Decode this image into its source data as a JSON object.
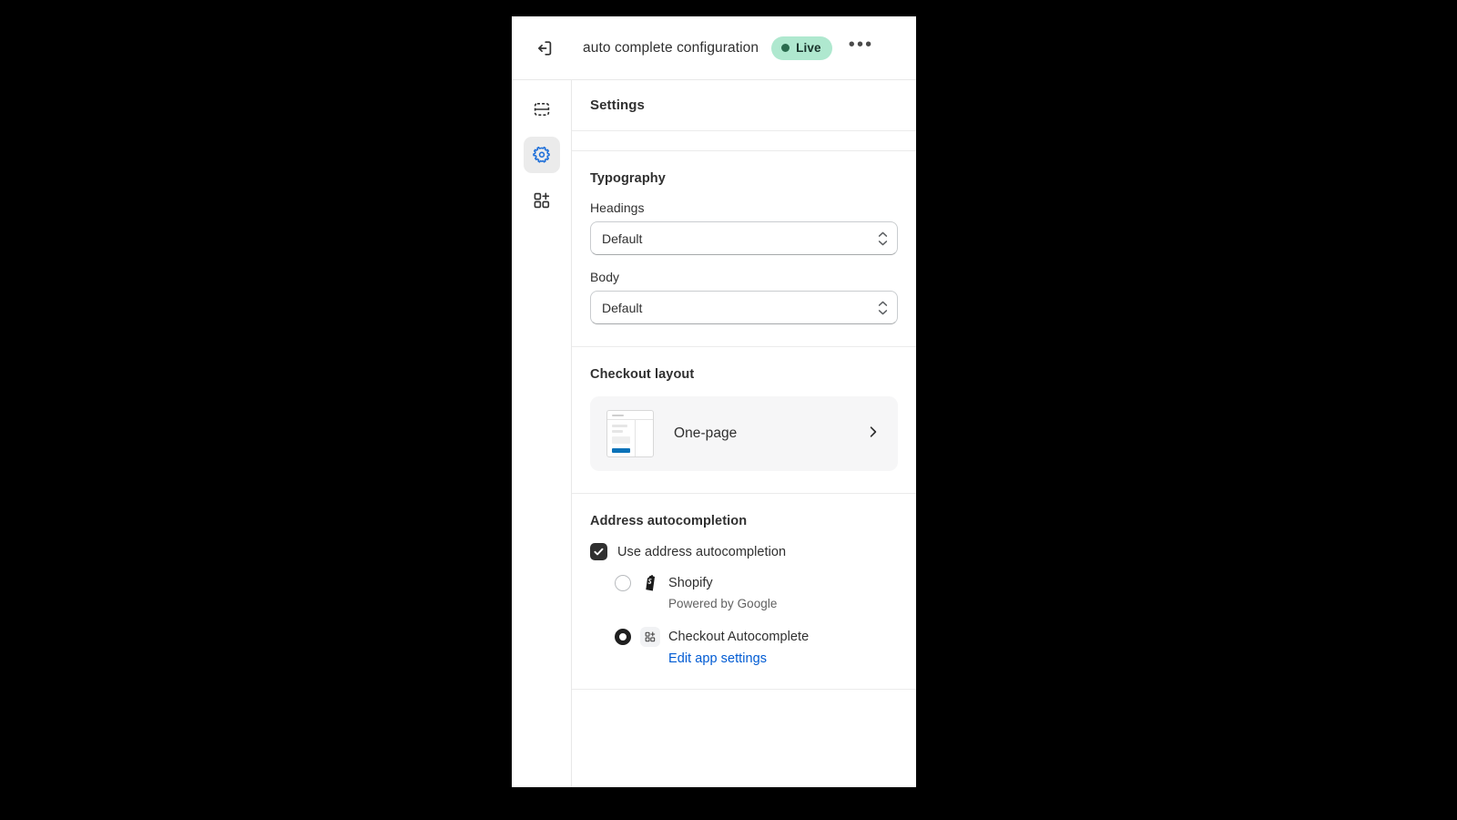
{
  "window": {
    "topbar": {
      "exit_icon": "exit-icon",
      "title": "auto complete configuration",
      "status_badge": {
        "label": "Live",
        "dot_color": "#2a6b4e",
        "background_color": "#afe8cf"
      },
      "more_label": "•••"
    },
    "rail": {
      "items": [
        {
          "name": "sections-icon",
          "active": false
        },
        {
          "name": "settings-gear-icon",
          "active": true
        },
        {
          "name": "app-blocks-add-icon",
          "active": false
        }
      ],
      "active_color": "#1e6fd9",
      "active_background": "#ebebeb"
    }
  },
  "panel": {
    "header_title": "Settings",
    "typography": {
      "section_title": "Typography",
      "headings": {
        "label": "Headings",
        "value": "Default"
      },
      "body": {
        "label": "Body",
        "value": "Default"
      }
    },
    "checkout_layout": {
      "section_title": "Checkout layout",
      "option": {
        "name": "One-page",
        "thumbnail_accent_color": "#0a72b8"
      }
    },
    "address_autocompletion": {
      "section_title": "Address autocompletion",
      "checkbox": {
        "label": "Use address autocompletion",
        "checked": true
      },
      "providers": [
        {
          "title": "Shopify",
          "subtitle": "Powered by Google",
          "selected": false,
          "icon": "shopify-bag-icon"
        },
        {
          "title": "Checkout Autocomplete",
          "link_label": "Edit app settings",
          "selected": true,
          "icon": "app-blocks-icon",
          "link_color": "#005bd3"
        }
      ]
    }
  }
}
